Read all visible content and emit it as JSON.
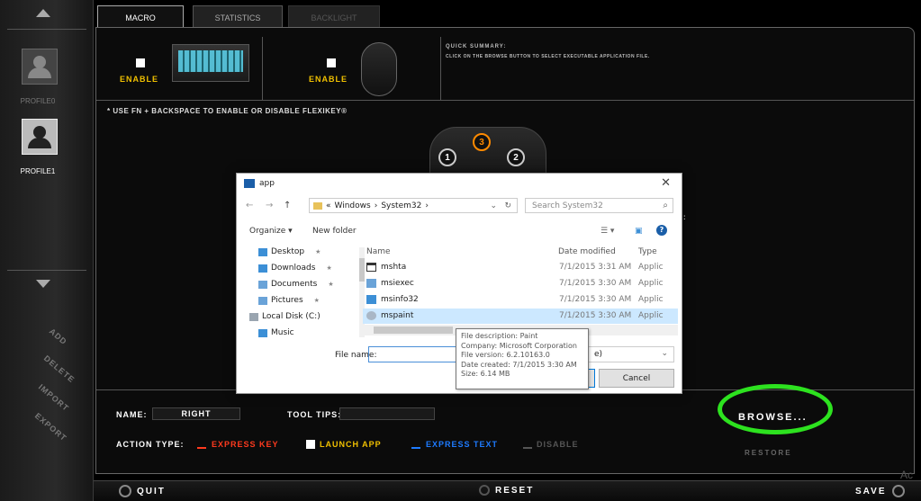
{
  "tabs": [
    {
      "label": "MACRO",
      "active": true
    },
    {
      "label": "STATISTICS",
      "active": false
    },
    {
      "label": "BACKLIGHT",
      "active": false
    }
  ],
  "sidebar": {
    "profiles": [
      {
        "label": "PROFILE0",
        "active": false
      },
      {
        "label": "PROFILE1",
        "active": true
      }
    ],
    "actions": [
      "ADD",
      "DELETE",
      "IMPORT",
      "EXPORT"
    ]
  },
  "devices": {
    "keyboard_enable_label": "ENABLE",
    "mouse_enable_label": "ENABLE"
  },
  "summary": {
    "title": "QUICK SUMMARY:",
    "text": "CLICK ON THE BROWSE BUTTON TO SELECT EXECUTABLE APPLICATION FILE."
  },
  "note": "* USE FN + BACKSPACE TO ENABLE OR DISABLE FLEXIKEY®",
  "mouse_buttons": [
    "1",
    "3",
    "2"
  ],
  "partial_label": ":",
  "fields": {
    "name_label": "NAME:",
    "name_value": "RIGHT",
    "tooltips_label": "TOOL TIPS:",
    "action_type_label": "ACTION TYPE:",
    "action_options": [
      {
        "label": "EXPRESS KEY",
        "color": "#ff3a1e",
        "selected": false
      },
      {
        "label": "LAUNCH APP",
        "color": "#f0c000",
        "selected": true
      },
      {
        "label": "EXPRESS TEXT",
        "color": "#1e7bff",
        "selected": false
      },
      {
        "label": "DISABLE",
        "color": "#555555",
        "selected": false
      }
    ],
    "browse_label": "BROWSE...",
    "restore_label": "RESTORE"
  },
  "bottom_bar": {
    "quit": "QUIT",
    "reset": "RESET",
    "save": "SAVE"
  },
  "watermark": "Ac",
  "dialog": {
    "title": "app",
    "address_parts": [
      "«",
      "Windows",
      "›",
      "System32",
      "›"
    ],
    "search_placeholder": "Search System32",
    "organize": "Organize ▾",
    "new_folder": "New folder",
    "nav_tree": [
      {
        "label": "Desktop",
        "icon_color": "#3c8fd6",
        "pinned": true
      },
      {
        "label": "Downloads",
        "icon_color": "#3c8fd6",
        "pinned": true
      },
      {
        "label": "Documents",
        "icon_color": "#6aa3d8",
        "pinned": true
      },
      {
        "label": "Pictures",
        "icon_color": "#6aa3d8",
        "pinned": true
      },
      {
        "label": "Local Disk (C:)",
        "icon_color": "#9aa5b0",
        "pinned": false
      },
      {
        "label": "Music",
        "icon_color": "#3c8fd6",
        "pinned": false
      }
    ],
    "columns": [
      "Name",
      "Date modified",
      "Type"
    ],
    "files": [
      {
        "name": "mshta",
        "date": "7/1/2015 3:31 AM",
        "type": "Applic",
        "selected": false
      },
      {
        "name": "msiexec",
        "date": "7/1/2015 3:30 AM",
        "type": "Applic",
        "selected": false
      },
      {
        "name": "msinfo32",
        "date": "7/1/2015 3:30 AM",
        "type": "Applic",
        "selected": false
      },
      {
        "name": "mspaint",
        "date": "7/1/2015 3:30 AM",
        "type": "Applic",
        "selected": true
      }
    ],
    "file_name_label": "File name:",
    "file_name_value": "",
    "type_select_fragment": "e)",
    "cancel": "Cancel",
    "tooltip": [
      "File description: Paint",
      "Company: Microsoft Corporation",
      "File version: 6.2.10163.0",
      "Date created: 7/1/2015 3:30 AM",
      "Size: 6.14 MB"
    ]
  },
  "colors": {
    "accent_yellow": "#f0c000",
    "highlight_green": "#2de21f",
    "mouse_orange": "#ff8a00"
  }
}
